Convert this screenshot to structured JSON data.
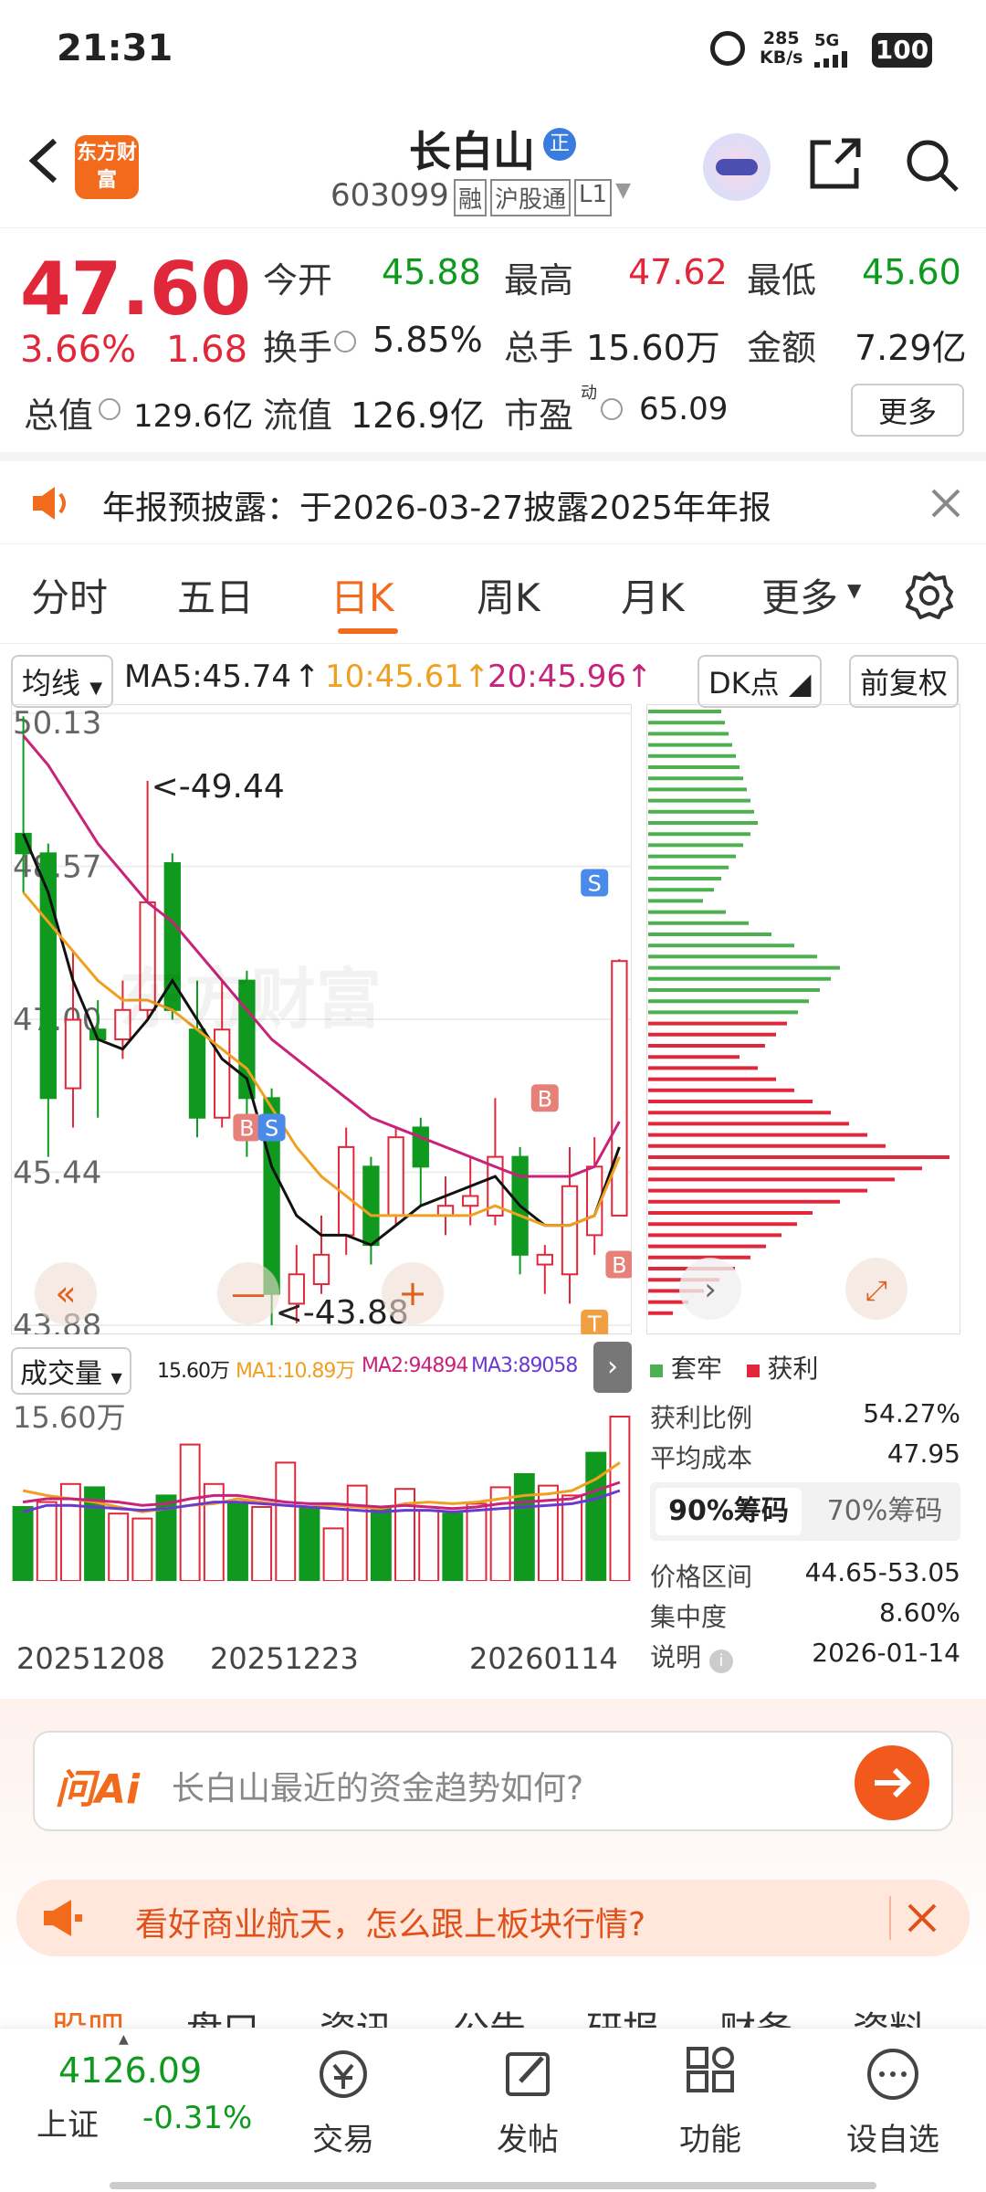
{
  "status": {
    "time": "21:31",
    "net_speed": "285",
    "net_unit": "KB/s",
    "network": "5G",
    "battery": "100"
  },
  "header": {
    "logo": "东方财富",
    "name": "长白山",
    "badge": "正",
    "code": "603099",
    "tags": [
      "融",
      "沪股通",
      "L1"
    ]
  },
  "quote": {
    "price": "47.60",
    "pct": "3.66%",
    "chg": "1.68",
    "open_l": "今开",
    "open": "45.88",
    "high_l": "最高",
    "high": "47.62",
    "low_l": "最低",
    "low": "45.60",
    "turn_l": "换手",
    "turn": "5.85%",
    "vol_l": "总手",
    "vol": "15.60万",
    "amt_l": "金额",
    "amt": "7.29亿",
    "mcap_l": "总值",
    "mcap": "129.6亿",
    "float_l": "流值",
    "float": "126.9亿",
    "pe_l": "市盈",
    "pe_sup": "动",
    "pe": "65.09",
    "more": "更多"
  },
  "notice": {
    "text": "年报预披露：于2026-03-27披露2025年年报"
  },
  "tabs": [
    "分时",
    "五日",
    "日K",
    "周K",
    "月K",
    "更多"
  ],
  "toolbar": {
    "ma_label": "均线",
    "ma5": "MA5:45.74",
    "ma10": "10:45.61",
    "ma20": "20:45.96",
    "dk": "DK点",
    "adjust": "前复权"
  },
  "chart_data": {
    "type": "candlestick",
    "yaxis": [
      "50.13",
      "48.57",
      "47.00",
      "45.44",
      "43.88"
    ],
    "high_label": "<-49.44",
    "low_label": "<-43.88",
    "colors": {
      "up": "#e0283a",
      "down": "#0f9a1f",
      "ma5": "#111111",
      "ma10": "#f0a020",
      "ma20": "#c8237a"
    },
    "candles": [
      [
        48.9,
        48.7,
        50.1,
        48.3
      ],
      [
        48.7,
        46.2,
        48.8,
        45.6
      ],
      [
        46.3,
        47.0,
        47.7,
        45.9
      ],
      [
        46.9,
        46.8,
        47.2,
        46.0
      ],
      [
        46.8,
        47.1,
        47.4,
        46.6
      ],
      [
        47.1,
        48.2,
        49.44,
        47.0
      ],
      [
        48.6,
        47.1,
        48.7,
        47.0
      ],
      [
        46.9,
        46.0,
        47.4,
        45.8
      ],
      [
        46.0,
        46.9,
        47.4,
        45.9
      ],
      [
        47.4,
        46.2,
        47.5,
        45.6
      ],
      [
        46.2,
        44.2,
        46.3,
        43.88
      ],
      [
        44.1,
        44.4,
        44.7,
        43.9
      ],
      [
        44.3,
        44.6,
        45.0,
        44.2
      ],
      [
        44.8,
        45.7,
        45.9,
        44.6
      ],
      [
        45.5,
        44.7,
        45.6,
        44.5
      ],
      [
        45.0,
        45.8,
        45.9,
        44.9
      ],
      [
        45.9,
        45.5,
        46.0,
        45.1
      ],
      [
        45.0,
        45.1,
        45.4,
        44.8
      ],
      [
        45.1,
        45.2,
        45.6,
        44.9
      ],
      [
        45.0,
        45.6,
        46.2,
        44.9
      ],
      [
        45.6,
        44.6,
        45.7,
        44.4
      ],
      [
        44.5,
        44.6,
        44.7,
        44.2
      ],
      [
        44.4,
        45.3,
        45.7,
        44.1
      ],
      [
        44.8,
        45.5,
        45.8,
        44.6
      ],
      [
        45.0,
        47.6,
        47.62,
        45.0
      ]
    ],
    "ma5": [
      48.9,
      48.3,
      47.4,
      46.8,
      46.7,
      47.0,
      47.4,
      47.0,
      46.6,
      46.4,
      45.5,
      45.0,
      44.8,
      44.8,
      44.7,
      44.9,
      45.1,
      45.2,
      45.3,
      45.4,
      45.1,
      44.9,
      44.9,
      45.0,
      45.7
    ],
    "ma10": [
      48.3,
      48.0,
      47.7,
      47.4,
      47.2,
      47.2,
      47.1,
      46.9,
      46.7,
      46.5,
      46.1,
      45.7,
      45.4,
      45.2,
      45.0,
      45.0,
      45.0,
      45.0,
      45.0,
      45.1,
      45.0,
      44.9,
      44.9,
      45.0,
      45.6
    ],
    "ma20": [
      49.9,
      49.6,
      49.2,
      48.8,
      48.5,
      48.2,
      48.0,
      47.7,
      47.4,
      47.1,
      46.8,
      46.6,
      46.4,
      46.2,
      46.0,
      45.9,
      45.8,
      45.7,
      45.6,
      45.5,
      45.4,
      45.4,
      45.4,
      45.5,
      45.96
    ],
    "volume": {
      "label": "成交量",
      "max": "15.60万",
      "ma1": "MA1:10.89万",
      "ma2": "MA2:94894",
      "ma3": "MA3:89058",
      "bars": [
        0.45,
        0.48,
        0.59,
        0.57,
        0.41,
        0.38,
        0.52,
        0.83,
        0.59,
        0.48,
        0.45,
        0.72,
        0.45,
        0.32,
        0.58,
        0.44,
        0.56,
        0.43,
        0.41,
        0.47,
        0.57,
        0.65,
        0.58,
        0.52,
        0.78,
        1.0
      ],
      "xlabels": [
        "20251208",
        "20251223",
        "20260114"
      ]
    }
  },
  "markers": [
    "B",
    "S",
    "B",
    "S",
    "B",
    "T"
  ],
  "chips": {
    "legend_trap": "套牢",
    "legend_profit": "获利",
    "rows": [
      [
        "获利比例",
        "54.27%"
      ],
      [
        "平均成本",
        "47.95"
      ]
    ],
    "tab90": "90%筹码",
    "tab70": "70%筹码",
    "rows2": [
      [
        "价格区间",
        "44.65-53.05"
      ],
      [
        "集中度",
        "8.60%"
      ],
      [
        "说明",
        "2026-01-14"
      ]
    ]
  },
  "ai": {
    "logo": "问Ai",
    "prompt": "长白山最近的资金趋势如何?"
  },
  "promo": {
    "text": "看好商业航天，怎么跟上板块行情?"
  },
  "subtabs": [
    "股吧",
    "盘口",
    "资讯",
    "公告",
    "研报",
    "财务",
    "资料"
  ],
  "bottom": {
    "index": "4126.09",
    "index_name": "上证",
    "index_pct": "-0.31%",
    "items": [
      "交易",
      "发帖",
      "功能",
      "设自选"
    ]
  }
}
